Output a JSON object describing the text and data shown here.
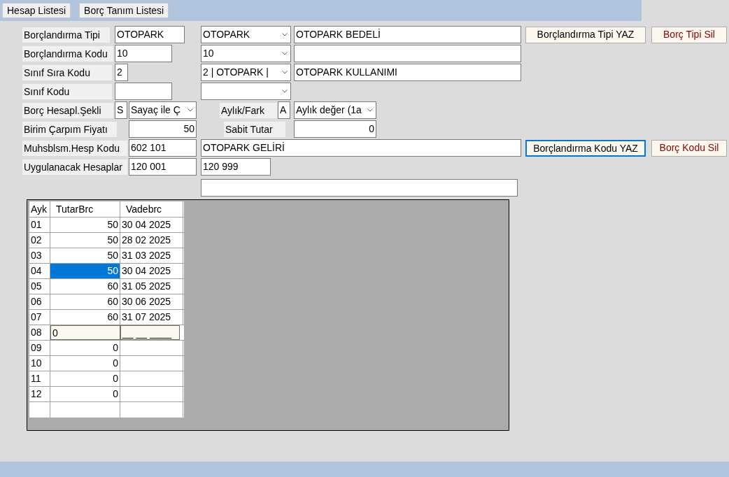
{
  "toolbar": {
    "buttons": [
      {
        "label": "Hesap Listesi"
      },
      {
        "label": "Borç Tanım Listesi"
      }
    ]
  },
  "form": {
    "borclandirma_tipi": {
      "label": "Borçlandırma Tipi",
      "code": "OTOPARK",
      "select": "OTOPARK",
      "description": "OTOPARK BEDELİ"
    },
    "borclandirma_kodu": {
      "label": "Borçlandırma Kodu",
      "code": "10",
      "select": "10"
    },
    "sinif_sira_kodu": {
      "label": "Sınıf Sıra Kodu",
      "code": "2",
      "select": "2 | OTOPARK |",
      "description": "OTOPARK KULLANIMI"
    },
    "sinif_kodu": {
      "label": "Sınıf Kodu"
    },
    "borc_hesapl_sekli": {
      "label": "Borç Hesapl.Şekli",
      "code": "S",
      "select": "Sayaç ile Ç"
    },
    "aylik_fark": {
      "label": "Aylık/Fark",
      "code": "A",
      "select": "Aylık değer (1a"
    },
    "birim_carpim_fiyati": {
      "label": "Birim Çarpım Fiyatı",
      "value": "50"
    },
    "sabit_tutar": {
      "label": "Sabit Tutar",
      "value": "0"
    },
    "muhsblsm_hesp_kodu": {
      "label": "Muhsblsm.Hesp Kodu",
      "code": "602 101",
      "description": "OTOPARK GELİRİ"
    },
    "uygulanacak_hesaplar": {
      "label": "Uygulanacak Hesaplar",
      "from": "120 001",
      "to": "120 999"
    }
  },
  "action_buttons": [
    {
      "label": "Borçlandırma Tipi YAZ",
      "kind": "save",
      "focused": false
    },
    {
      "label": "Borç Tipi Sil",
      "kind": "delete",
      "focused": false
    },
    {
      "label": "Borçlandırma Kodu YAZ",
      "kind": "save",
      "focused": true
    },
    {
      "label": "Borç Kodu Sil",
      "kind": "delete",
      "focused": false
    }
  ],
  "grid": {
    "columns": [
      "Ayk",
      "TutarBrc",
      "Vadebrc"
    ],
    "rows": [
      {
        "ay": "01",
        "tutar": "50",
        "vade": "30 04 2025",
        "selected": false,
        "editing": false
      },
      {
        "ay": "02",
        "tutar": "50",
        "vade": "28 02 2025",
        "selected": false,
        "editing": false
      },
      {
        "ay": "03",
        "tutar": "50",
        "vade": "31 03 2025",
        "selected": false,
        "editing": false
      },
      {
        "ay": "04",
        "tutar": "50",
        "vade": "30 04 2025",
        "selected": true,
        "editing": false
      },
      {
        "ay": "05",
        "tutar": "60",
        "vade": "31 05 2025",
        "selected": false,
        "editing": false
      },
      {
        "ay": "06",
        "tutar": "60",
        "vade": "30 06 2025",
        "selected": false,
        "editing": false
      },
      {
        "ay": "07",
        "tutar": "60",
        "vade": "31 07 2025",
        "selected": false,
        "editing": false
      },
      {
        "ay": "08",
        "tutar": "0",
        "vade": "__ __ ____",
        "selected": false,
        "editing": true
      },
      {
        "ay": "09",
        "tutar": "0",
        "selected": false,
        "editing": false
      },
      {
        "ay": "10",
        "tutar": "0",
        "selected": false,
        "editing": false
      },
      {
        "ay": "11",
        "tutar": "0",
        "selected": false,
        "editing": false
      },
      {
        "ay": "12",
        "tutar": "0",
        "selected": false,
        "editing": false
      }
    ]
  }
}
